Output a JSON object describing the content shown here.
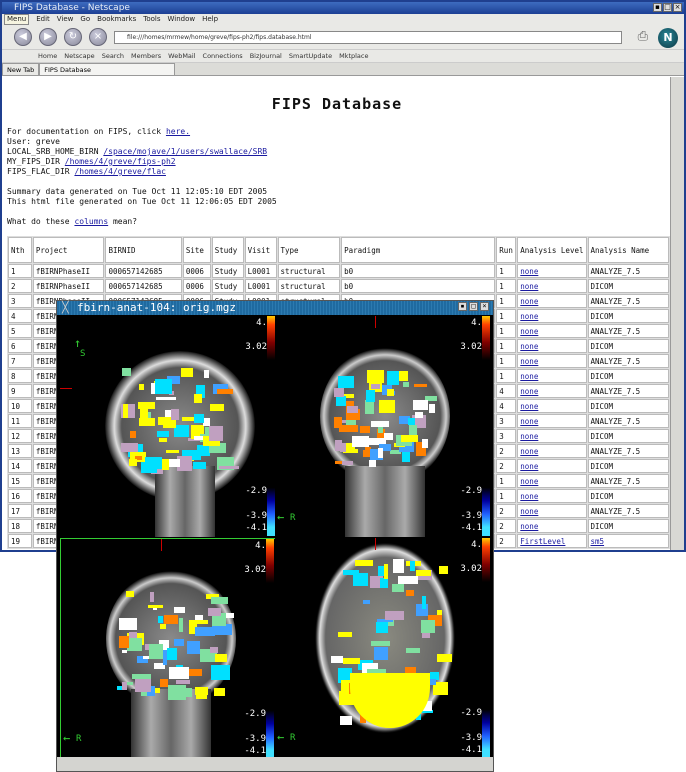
{
  "browser": {
    "title": "FIPS Database - Netscape",
    "menu": [
      "Menu",
      "Edit",
      "View",
      "Go",
      "Bookmarks",
      "Tools",
      "Window",
      "Help"
    ],
    "url": "file:///homes/mrmew/home/greve/fips-ph2/fips.database.html",
    "bookmarks": [
      "Home",
      "Netscape",
      "Search",
      "Members",
      "WebMail",
      "Connections",
      "BizJournal",
      "SmartUpdate",
      "Mktplace"
    ],
    "tabs": [
      "New Tab",
      "FIPS Database"
    ]
  },
  "page": {
    "heading": "FIPS Database",
    "doc_prefix": "For documentation on FIPS, click ",
    "doc_link": "here.",
    "user": "User: greve",
    "srb_label": "LOCAL_SRB_HOME_BIRN ",
    "srb_link": "/space/mojave/1/users/swallace/SRB",
    "fips_label": "MY_FIPS_DIR ",
    "fips_link": "/homes/4/greve/fips-ph2",
    "flac_label": "FIPS_FLAC_DIR ",
    "flac_link": "/homes/4/greve/flac",
    "summary": "Summary data generated on Tue Oct 11 12:05:10 EDT 2005",
    "html_gen": "This html file generated on Tue Oct 11 12:06:05 EDT 2005",
    "cols_prefix": "What do these ",
    "cols_link": "columns",
    "cols_suffix": " mean?"
  },
  "table": {
    "headers": [
      "Nth",
      "Project",
      "BIRNID",
      "Site",
      "Study",
      "Visit",
      "Type",
      "Paradigm",
      "Run",
      "Analysis Level",
      "Analysis Name"
    ],
    "rows": [
      [
        "1",
        "fBIRNPhaseII",
        "000657142685",
        "0006",
        "Study",
        "L0001",
        "structural",
        "b0",
        "1",
        "none",
        "ANALYZE_7.5"
      ],
      [
        "2",
        "fBIRNPhaseII",
        "000657142685",
        "0006",
        "Study",
        "L0001",
        "structural",
        "b0",
        "1",
        "none",
        "DICOM"
      ],
      [
        "3",
        "fBIRNPhaseII",
        "000657142685",
        "0006",
        "Study",
        "L0001",
        "structural",
        "b0",
        "1",
        "none",
        "ANALYZE_7.5"
      ],
      [
        "4",
        "fBIRNPhaseII",
        "",
        "",
        "",
        "",
        "",
        "",
        "1",
        "none",
        "DICOM"
      ],
      [
        "5",
        "fBIRNPhaseII",
        "",
        "",
        "",
        "",
        "",
        "",
        "1",
        "none",
        "ANALYZE_7.5"
      ],
      [
        "6",
        "fBIRNPhaseII",
        "",
        "",
        "",
        "",
        "",
        "",
        "1",
        "none",
        "DICOM"
      ],
      [
        "7",
        "fBIRNPhaseII",
        "",
        "",
        "",
        "",
        "",
        "",
        "1",
        "none",
        "ANALYZE_7.5"
      ],
      [
        "8",
        "fBIRNPhaseII",
        "",
        "",
        "",
        "",
        "",
        "",
        "1",
        "none",
        "DICOM"
      ],
      [
        "9",
        "fBIRNPhaseII",
        "",
        "",
        "",
        "",
        "",
        "",
        "4",
        "none",
        "ANALYZE_7.5"
      ],
      [
        "10",
        "fBIRNPhaseII",
        "",
        "",
        "",
        "",
        "",
        "",
        "4",
        "none",
        "DICOM"
      ],
      [
        "11",
        "fBIRNPhaseII",
        "",
        "",
        "",
        "",
        "",
        "",
        "3",
        "none",
        "ANALYZE_7.5"
      ],
      [
        "12",
        "fBIRNPhaseII",
        "",
        "",
        "",
        "",
        "",
        "",
        "3",
        "none",
        "DICOM"
      ],
      [
        "13",
        "fBIRNPhaseII",
        "",
        "",
        "",
        "",
        "",
        "",
        "2",
        "none",
        "ANALYZE_7.5"
      ],
      [
        "14",
        "fBIRNPhaseII",
        "",
        "",
        "",
        "",
        "",
        "",
        "2",
        "none",
        "DICOM"
      ],
      [
        "15",
        "fBIRNPhaseII",
        "",
        "",
        "",
        "",
        "",
        "",
        "1",
        "none",
        "ANALYZE_7.5"
      ],
      [
        "16",
        "fBIRNPhaseII",
        "",
        "",
        "",
        "",
        "",
        "",
        "1",
        "none",
        "DICOM"
      ],
      [
        "17",
        "fBIRNPhaseII",
        "",
        "",
        "",
        "",
        "",
        "",
        "2",
        "none",
        "ANALYZE_7.5"
      ],
      [
        "18",
        "fBIRNPhaseII",
        "",
        "",
        "",
        "",
        "",
        "",
        "2",
        "none",
        "DICOM"
      ],
      [
        "19",
        "fBIRNPhaseII",
        "",
        "",
        "",
        "",
        "",
        "",
        "2",
        "FirstLevel",
        "sm5"
      ]
    ]
  },
  "viewer": {
    "title": "fbirn-anat-104: orig.mgz",
    "labels": {
      "pos_max": "4.",
      "pos_min": "3.02",
      "neg_min": "-2.9",
      "neg_mid": "-3.9",
      "neg_max": "-4.1",
      "axis_s": "S",
      "axis_r": "R"
    }
  },
  "colors": {
    "accent": "#1c3f94",
    "link": "#1a1aa0",
    "viewer_title": "#1f6aa0"
  }
}
